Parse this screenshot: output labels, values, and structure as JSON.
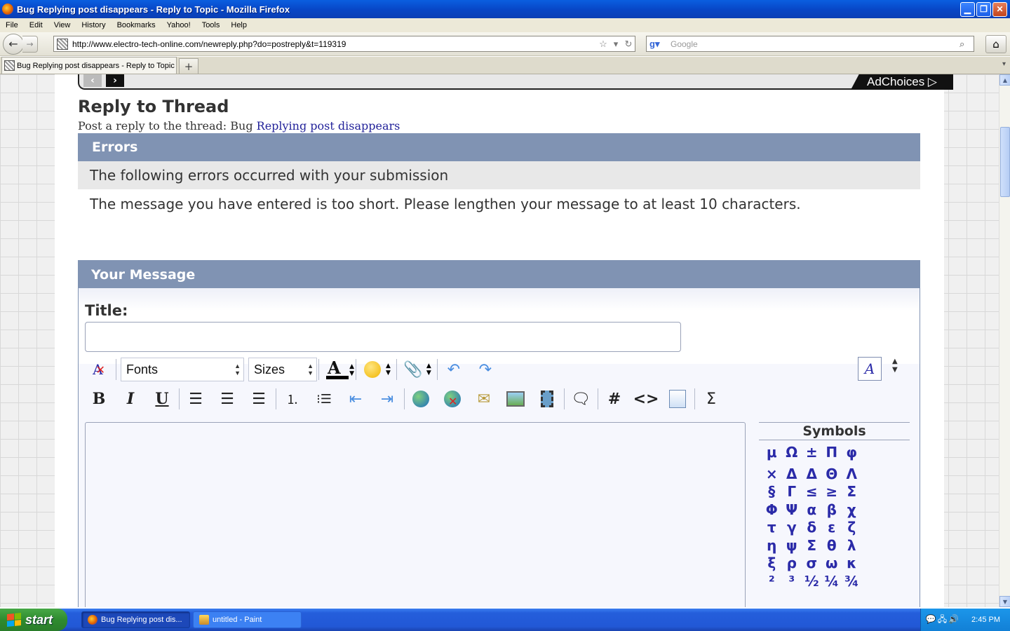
{
  "window": {
    "title": "Bug Replying post disappears - Reply to Topic - Mozilla Firefox",
    "minimize": "▁",
    "maximize": "❐",
    "close": "✕"
  },
  "menu": [
    "File",
    "Edit",
    "View",
    "History",
    "Bookmarks",
    "Yahoo!",
    "Tools",
    "Help"
  ],
  "nav": {
    "url": "http://www.electro-tech-online.com/newreply.php?do=postreply&t=119319",
    "search_placeholder": "Google"
  },
  "tabs": {
    "active_label": "Bug Replying post disappears - Reply to Topic",
    "new_tab": "+"
  },
  "ad": {
    "choices_label": "AdChoices ▷"
  },
  "page": {
    "heading": "Reply to Thread",
    "subheading_prefix": "Post a reply to the thread: Bug ",
    "thread_link": "Replying post disappears"
  },
  "errors": {
    "header": "Errors",
    "subheader": "The following errors occurred with your submission",
    "message": "The message you have entered is too short. Please lengthen your message to at least 10 characters."
  },
  "message_form": {
    "header": "Your Message",
    "title_label": "Title:",
    "title_value": "",
    "fonts_label": "Fonts",
    "sizes_label": "Sizes"
  },
  "symbols": {
    "header": "Symbols",
    "items": [
      "μ",
      "Ω",
      "±",
      "Π",
      "φ",
      "×",
      "Δ",
      "Δ",
      "Θ",
      "Λ",
      "§",
      "Γ",
      "≤",
      "≥",
      "Σ",
      "Φ",
      "Ψ",
      "α",
      "β",
      "χ",
      "τ",
      "γ",
      "δ",
      "ε",
      "ζ",
      "η",
      "ψ",
      "Σ",
      "θ",
      "λ",
      "ξ",
      "ρ",
      "σ",
      "ω",
      "κ",
      "²",
      "³",
      "½",
      "¼",
      "¾"
    ]
  },
  "taskbar": {
    "start": "start",
    "items": [
      {
        "label": "Bug Replying post dis..."
      },
      {
        "label": "untitled - Paint"
      }
    ],
    "clock": "2:45 PM"
  },
  "colors": {
    "section_header": "#8093b3",
    "link": "#22229a",
    "symbol": "#2a2aa8"
  }
}
